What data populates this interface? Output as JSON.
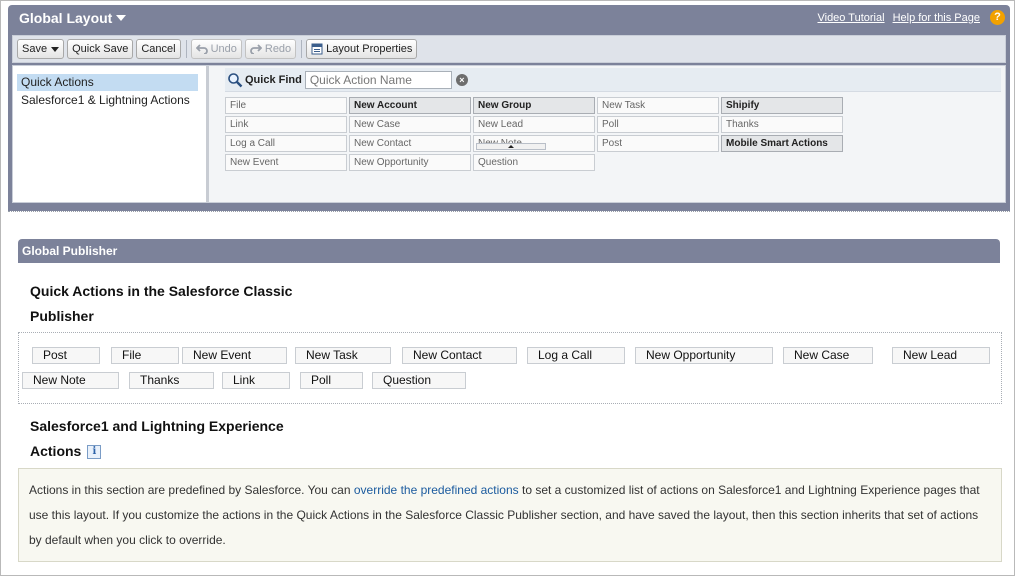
{
  "header": {
    "title": "Global Layout",
    "video_tutorial": "Video Tutorial",
    "help_link": "Help for this Page",
    "help_icon": "?"
  },
  "toolbar": {
    "save": "Save",
    "quick_save": "Quick Save",
    "cancel": "Cancel",
    "undo": "Undo",
    "redo": "Redo",
    "layout_properties": "Layout Properties"
  },
  "palette": {
    "categories": [
      "Quick Actions",
      "Salesforce1 & Lightning Actions"
    ],
    "selected_category": "Quick Actions",
    "quick_find_label": "Quick Find",
    "quick_find_placeholder": "Quick Action Name",
    "actions": [
      {
        "label": "File",
        "used": false
      },
      {
        "label": "New Account",
        "used": true
      },
      {
        "label": "New Group",
        "used": true
      },
      {
        "label": "New Task",
        "used": false
      },
      {
        "label": "Shipify",
        "used": true
      },
      {
        "label": "Link",
        "used": false
      },
      {
        "label": "New Case",
        "used": false
      },
      {
        "label": "New Lead",
        "used": false
      },
      {
        "label": "Poll",
        "used": false
      },
      {
        "label": "Thanks",
        "used": false
      },
      {
        "label": "Log a Call",
        "used": false
      },
      {
        "label": "New Contact",
        "used": false
      },
      {
        "label": "New Note",
        "used": false
      },
      {
        "label": "Post",
        "used": false
      },
      {
        "label": "Mobile Smart Actions",
        "used": true
      },
      {
        "label": "New Event",
        "used": false
      },
      {
        "label": "New Opportunity",
        "used": false
      },
      {
        "label": "Question",
        "used": false
      }
    ]
  },
  "publisher": {
    "header": "Global Publisher",
    "classic_title_line1": "Quick Actions in the Salesforce Classic",
    "classic_title_line2": "Publisher",
    "classic_actions": [
      "Post",
      "File",
      "New Event",
      "New Task",
      "New Contact",
      "Log a Call",
      "New Opportunity",
      "New Case",
      "New Lead",
      "New Note",
      "Thanks",
      "Link",
      "Poll",
      "Question"
    ],
    "s1_title_line1": "Salesforce1 and Lightning Experience",
    "s1_title_line2": "Actions",
    "s1_info_icon": "i",
    "s1_text_before": "Actions in this section are predefined by Salesforce. You can ",
    "s1_link": "override the predefined actions",
    "s1_text_after": " to set a customized list of actions on Salesforce1 and Lightning Experience pages that use this layout. If you customize the actions in the Quick Actions in the Salesforce Classic Publisher section, and have saved the layout, then this section inherits that set of actions by default when you click to override."
  },
  "colors": {
    "header_bg": "#7c829a",
    "selected_category_bg": "#c3dcf2",
    "link": "#1a5a9e",
    "help_icon": "#f2a100"
  }
}
